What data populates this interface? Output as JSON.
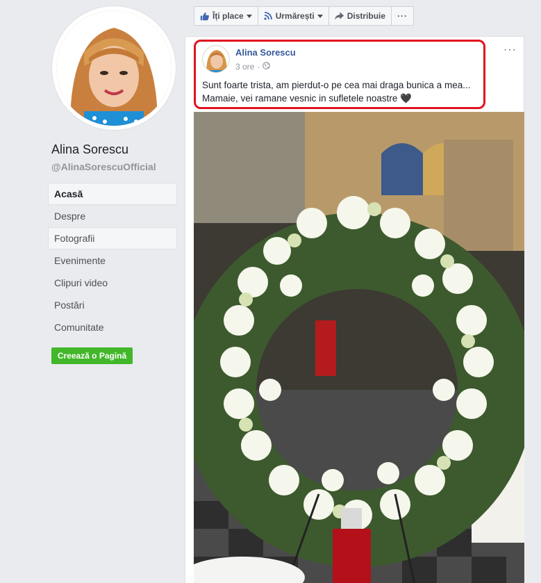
{
  "page": {
    "name": "Alina Sorescu",
    "handle": "@AlinaSorescuOfficial"
  },
  "nav": {
    "items": [
      {
        "label": "Acasă"
      },
      {
        "label": "Despre"
      },
      {
        "label": "Fotografii"
      },
      {
        "label": "Evenimente"
      },
      {
        "label": "Clipuri video"
      },
      {
        "label": "Postări"
      },
      {
        "label": "Comunitate"
      }
    ],
    "create_page": "Creează o Pagină"
  },
  "actions": {
    "like": "Îți place",
    "follow": "Urmărești",
    "share": "Distribuie",
    "more": "···"
  },
  "post": {
    "author": "Alina Sorescu",
    "time": "3 ore",
    "separator": "·",
    "more": "···",
    "text_line1": "Sunt foarte trista, am pierdut-o pe cea mai draga bunica a mea...",
    "text_line2": "Mamaie, vei ramane vesnic in sufletele noastre 🖤"
  },
  "colors": {
    "link": "#365899",
    "highlight": "#e0131f",
    "create_button": "#42b72a"
  }
}
